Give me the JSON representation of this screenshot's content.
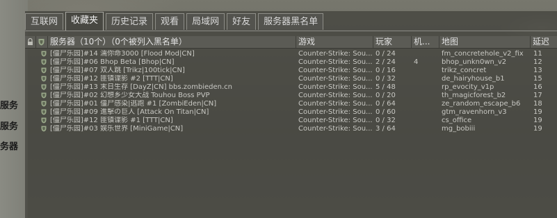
{
  "background_left_labels": [
    "服务",
    "服务",
    "务器"
  ],
  "tabs": [
    {
      "label": "互联网",
      "active": false
    },
    {
      "label": "收藏夹",
      "active": true
    },
    {
      "label": "历史记录",
      "active": false
    },
    {
      "label": "观看",
      "active": false
    },
    {
      "label": "局域网",
      "active": false
    },
    {
      "label": "好友",
      "active": false
    },
    {
      "label": "服务器黑名单",
      "active": false
    }
  ],
  "columns": {
    "lock_icon": "lock-icon",
    "secure_icon": "shield-icon",
    "servers": "服务器（10个）（0个被列入黑名单）",
    "game": "游戏",
    "players": "玩家",
    "bots": "机...",
    "map": "地图",
    "latency": "延迟"
  },
  "rows": [
    {
      "name": "[僵尸乐园]#14 濡你命3000 [Flood Mod|CN]",
      "game": "Counter-Strike: Sou...",
      "players": "0 / 24",
      "bots": "",
      "map": "fm_concretehole_v2_fix",
      "latency": "11"
    },
    {
      "name": "[僵尸乐园]#06 Bhop Beta [Bhop|CN]",
      "game": "Counter-Strike: Sou...",
      "players": "2 / 24",
      "bots": "4",
      "map": "bhop_unkn0wn_v2",
      "latency": "12"
    },
    {
      "name": "[僵尸乐园]#07 双人跳 [Trikz|100tick|CN]",
      "game": "Counter-Strike: Sou...",
      "players": "0 / 16",
      "bots": "",
      "map": "trikz_concret",
      "latency": "13"
    },
    {
      "name": "[僵尸乐园]#12 匪镇谍影 #2 [TTT|CN]",
      "game": "Counter-Strike: Sou...",
      "players": "0 / 32",
      "bots": "",
      "map": "de_hairyhouse_b1",
      "latency": "15"
    },
    {
      "name": "[僵尸乐园]#13 末日生存 [DayZ|CN] bbs.zombieden.cn",
      "game": "Counter-Strike: Sou...",
      "players": "5 / 48",
      "bots": "",
      "map": "rp_evocity_v1p",
      "latency": "16"
    },
    {
      "name": "[僵尸乐园]#02 幻想乡少女大战 Touhou Boss PVP",
      "game": "Counter-Strike: Sou...",
      "players": "0 / 20",
      "bots": "",
      "map": "th_magicforest_b2",
      "latency": "17"
    },
    {
      "name": "[僵尸乐园]#01 僵尸感染|逃跑 #1 [ZombiEden|CN]",
      "game": "Counter-Strike: Sou...",
      "players": "0 / 64",
      "bots": "",
      "map": "ze_random_escape_b6",
      "latency": "18"
    },
    {
      "name": "[僵尸乐园]#09 進擊の巨人 [Attack On Titan|CN]",
      "game": "Counter-Strike: Sou...",
      "players": "0 / 60",
      "bots": "",
      "map": "gtm_ravenhorn_v3",
      "latency": "19"
    },
    {
      "name": "[僵尸乐园]#12 匪镇谍影 #1 [TTT|CN]",
      "game": "Counter-Strike: Sou...",
      "players": "0 / 32",
      "bots": "",
      "map": "cs_office",
      "latency": "19"
    },
    {
      "name": "[僵尸乐园]#03 娱乐世界 [MiniGame|CN]",
      "game": "Counter-Strike: Sou...",
      "players": "3 / 64",
      "bots": "",
      "map": "mg_bobiii",
      "latency": "19"
    }
  ],
  "colors": {
    "text": "#c9c9c4",
    "header_text": "#e2e2e2",
    "shield": "#9aa88a"
  }
}
